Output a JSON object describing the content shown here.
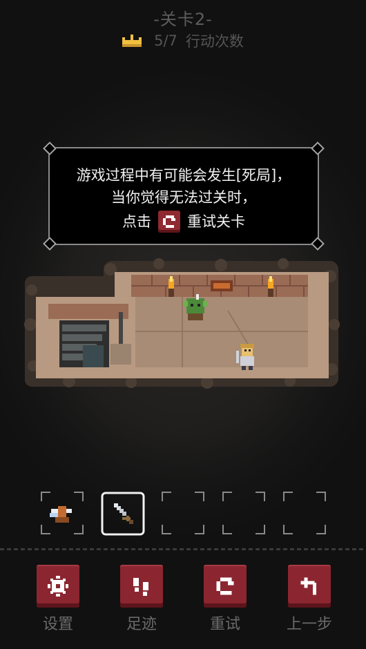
{
  "header": {
    "level_title": "-关卡2-",
    "moves": "5/7",
    "moves_label": "行动次数"
  },
  "tip": {
    "line1": "游戏过程中有可能会发生[死局]，",
    "line2": "当你觉得无法过关时，",
    "line3_prefix": "点击",
    "line3_suffix": "重试关卡"
  },
  "inventory": {
    "slots": [
      {
        "item": "winged-boots-icon",
        "selected": false
      },
      {
        "item": "sword-icon",
        "selected": true
      },
      {
        "item": "",
        "selected": false
      },
      {
        "item": "",
        "selected": false
      },
      {
        "item": "",
        "selected": false
      }
    ]
  },
  "buttons": {
    "settings": "设置",
    "footprints": "足迹",
    "retry": "重试",
    "undo": "上一步"
  },
  "colors": {
    "button_red": "#8b2630",
    "tip_text": "#f2f2f2",
    "crown_gold": "#f0c040"
  }
}
